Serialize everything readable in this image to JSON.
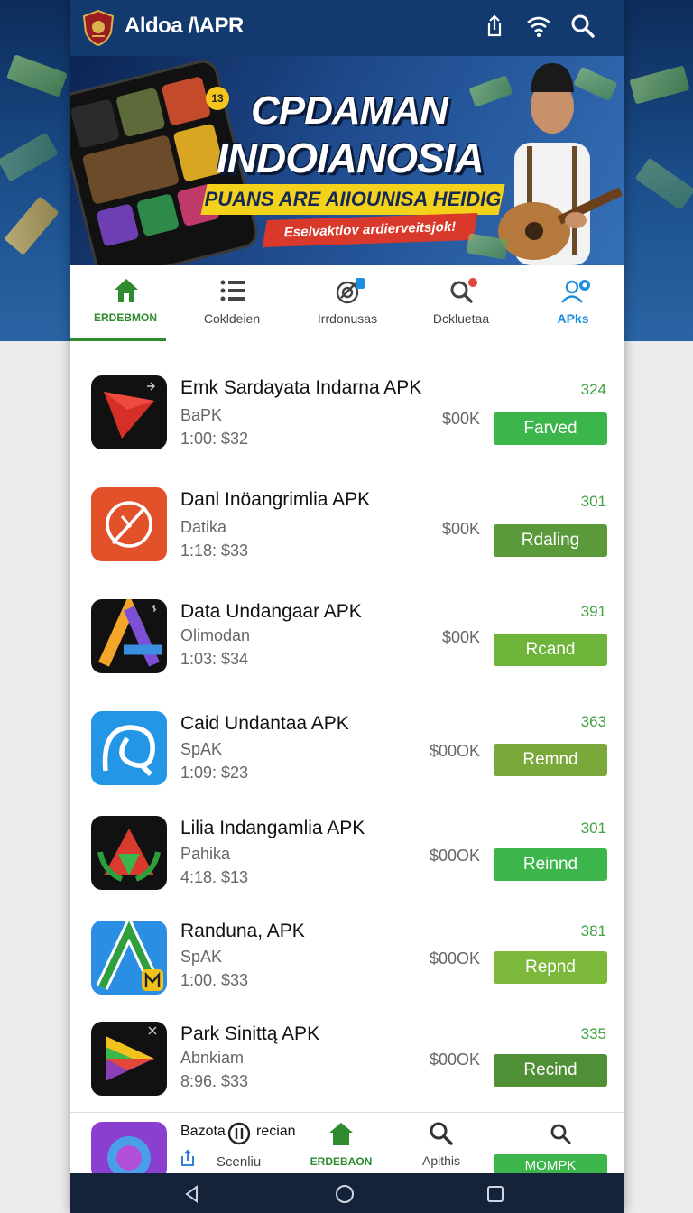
{
  "app": {
    "title": "Aldoa /\\APR"
  },
  "banner": {
    "badge": "13",
    "headline1": "CPDAMAN",
    "headline2": "INDOIANOSIA",
    "strip": "PUANS ARE AIIOUNISA HEIDIG",
    "tagline": "Eselvaktiov ardierveitsjok!"
  },
  "tabs": [
    {
      "label": "ERDEBMON",
      "icon": "home-icon"
    },
    {
      "label": "Cokldeien",
      "icon": "list-icon"
    },
    {
      "label": "Irrdonusas",
      "icon": "target-icon"
    },
    {
      "label": "Dckluetaa",
      "icon": "search-icon"
    },
    {
      "label": "APks",
      "icon": "user-icon"
    }
  ],
  "apps": [
    {
      "title": "Emk Sardayata Indarna APK",
      "sub": "BaPK",
      "meta": "1:00: $32",
      "price": "$00K",
      "count": "324",
      "button": "Farved",
      "button_color": "#3cb54a"
    },
    {
      "title": "Danl Inöangrimlia APK",
      "sub": "Datika",
      "meta": "1:18: $33",
      "price": "$00K",
      "count": "301",
      "button": "Rdaling",
      "button_color": "#5a9a3a"
    },
    {
      "title": "Data Undangaar APK",
      "sub": "Olimodan",
      "meta": "1:03: $34",
      "price": "$00K",
      "count": "391",
      "button": "Rcand",
      "button_color": "#6eb33a"
    },
    {
      "title": "Caid Undantaa APK",
      "sub": "SpAK",
      "meta": "1:09: $23",
      "price": "$00OK",
      "count": "363",
      "button": "Remnd",
      "button_color": "#7aa83a"
    },
    {
      "title": "Lilia Indangamlia APK",
      "sub": "Pahika",
      "meta": "4:18. $13",
      "price": "$00OK",
      "count": "301",
      "button": "Reinnd",
      "button_color": "#3cb54a"
    },
    {
      "title": "Randuna, APK",
      "sub": "SpAK",
      "meta": "1:00. $33",
      "price": "$00OK",
      "count": "381",
      "button": "Repnd",
      "button_color": "#7cb83a"
    },
    {
      "title": "Park Sinittą APK",
      "sub": "Abnkiam",
      "meta": "8:96. $33",
      "price": "$00OK",
      "count": "335",
      "button": "Recind",
      "button_color": "#4f8f35"
    }
  ],
  "partial_row": {
    "title": "Bazota",
    "title2": "recian",
    "sub": "Scenliu"
  },
  "bottom_nav": [
    {
      "label": "ERDEBAON"
    },
    {
      "label": "Apithis"
    },
    {
      "label": "MOMPK"
    }
  ]
}
